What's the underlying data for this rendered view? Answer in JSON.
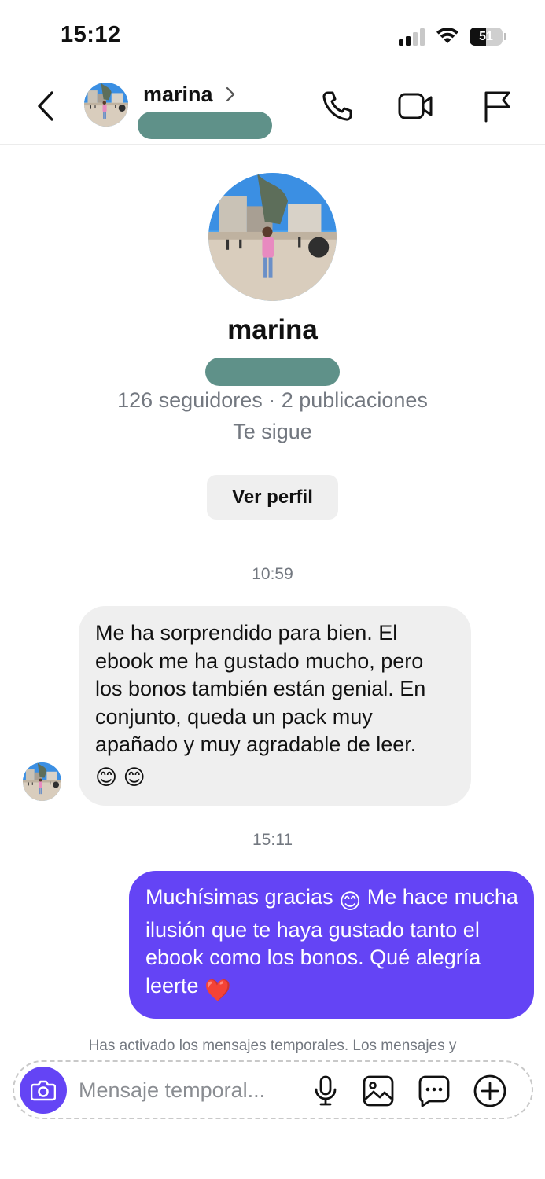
{
  "status_bar": {
    "time": "15:12",
    "battery_percent": "51"
  },
  "header": {
    "name": "marina",
    "icons": [
      "back-icon",
      "avatar",
      "chevron-right-icon",
      "phone-icon",
      "video-camera-icon",
      "flag-icon"
    ]
  },
  "profile": {
    "name": "marina",
    "stats": "126 seguidores · 2 publicaciones",
    "follows_you": "Te sigue",
    "view_profile_label": "Ver perfil"
  },
  "conversation": {
    "messages": [
      {
        "time": "10:59",
        "direction": "incoming",
        "text": "Me ha sorprendido para bien. El ebook me ha gustado mucho, pero los bonos también están genial. En conjunto, queda un pack muy apañado y muy agradable de leer.",
        "emojis": "😊 😊"
      },
      {
        "time": "15:11",
        "direction": "outgoing",
        "text_before_emoji": "Muchísimas gracias",
        "inline_emoji": "😊",
        "text_after_emoji": " Me hace mucha ilusión que te haya gustado tanto el ebook como los bonos. Qué alegría leerte",
        "trailing_emoji": "❤️"
      }
    ]
  },
  "disclaimer": "Has activado los mensajes temporales. Los mensajes y",
  "composer": {
    "placeholder": "Mensaje temporal...",
    "icons": [
      "camera-icon",
      "microphone-icon",
      "gallery-icon",
      "sticker-icon",
      "plus-icon"
    ]
  },
  "colors": {
    "accent": "#6444f5",
    "incoming_bubble": "#efefef",
    "redaction": "#5f9189",
    "secondary_text": "#737880"
  }
}
